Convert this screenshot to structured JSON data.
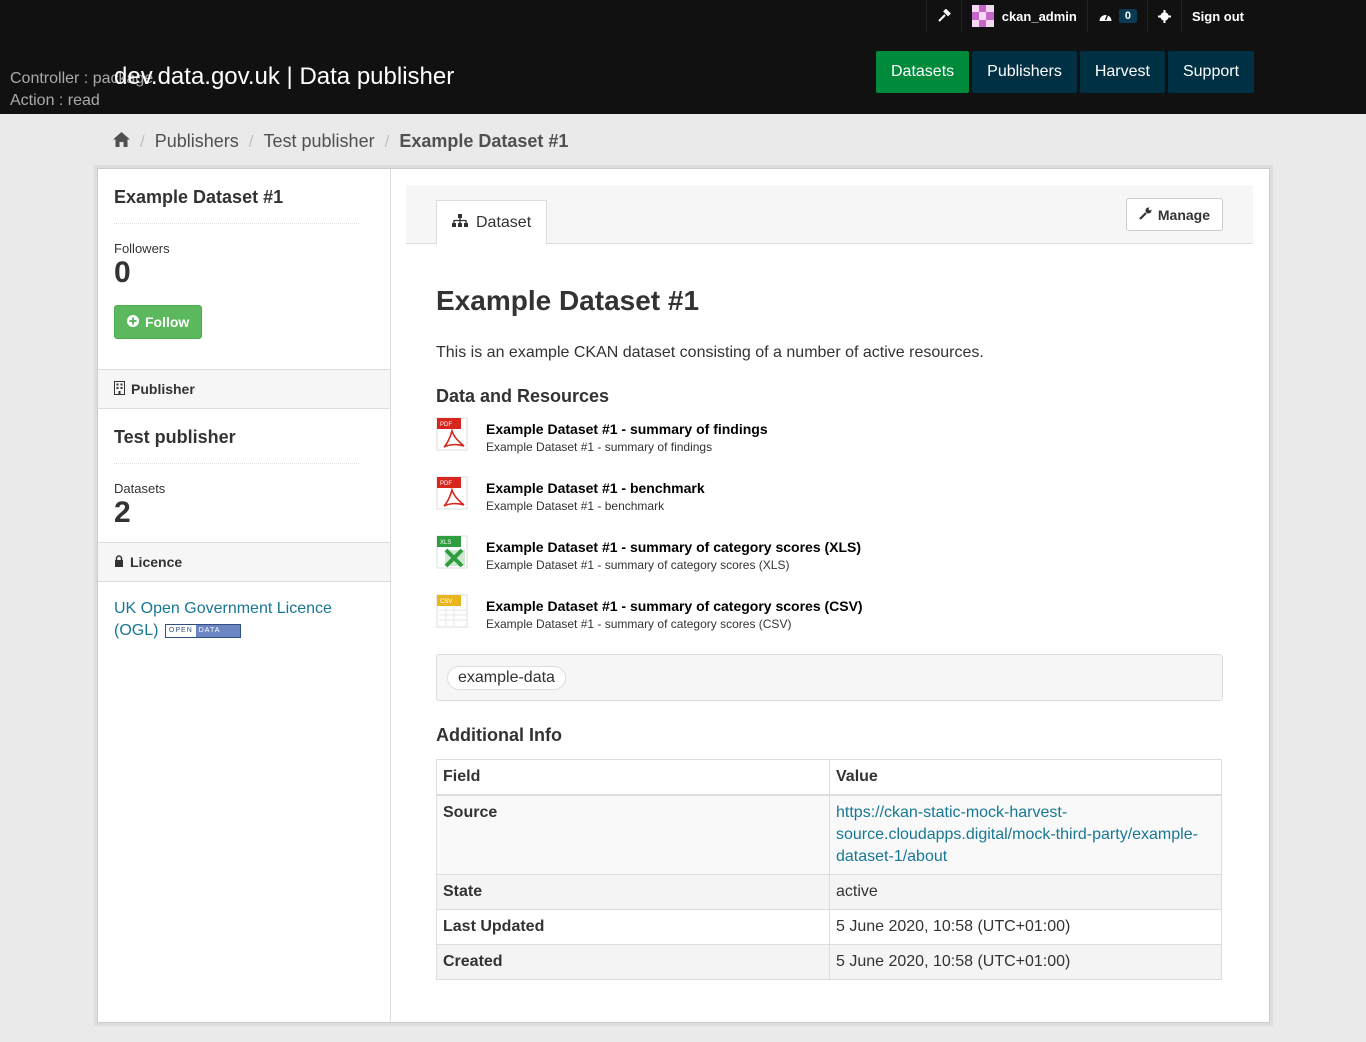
{
  "account": {
    "username": "ckan_admin",
    "dashboard_count": "0",
    "signout_label": "Sign out"
  },
  "debug": {
    "controller": "Controller : package",
    "action": "Action : read"
  },
  "site": {
    "title": "dev.data.gov.uk | Data publisher"
  },
  "nav": {
    "items": [
      {
        "label": "Datasets",
        "active": true
      },
      {
        "label": "Publishers",
        "active": false
      },
      {
        "label": "Harvest",
        "active": false
      },
      {
        "label": "Support",
        "active": false
      }
    ]
  },
  "breadcrumb": {
    "items": [
      "Publishers",
      "Test publisher"
    ],
    "current": "Example Dataset #1"
  },
  "sidebar": {
    "dataset_title": "Example Dataset #1",
    "followers_label": "Followers",
    "followers_count": "0",
    "follow_label": "Follow",
    "publisher_heading": "Publisher",
    "publisher_name": "Test publisher",
    "datasets_label": "Datasets",
    "datasets_count": "2",
    "licence_heading": "Licence",
    "licence_text": "UK Open Government Licence (OGL)",
    "ogl_badge_open": "OPEN",
    "ogl_badge_data": "DATA"
  },
  "tabs": {
    "dataset_label": "Dataset",
    "manage_label": "Manage"
  },
  "dataset": {
    "title": "Example Dataset #1",
    "notes": "This is an example CKAN dataset consisting of a number of active resources.",
    "resources_heading": "Data and Resources",
    "resources": [
      {
        "name": "Example Dataset #1 - summary of findings",
        "description": "Example Dataset #1 - summary of findings",
        "format": "PDF",
        "color": "#d8261f"
      },
      {
        "name": "Example Dataset #1 - benchmark",
        "description": "Example Dataset #1 - benchmark",
        "format": "PDF",
        "color": "#d8261f"
      },
      {
        "name": "Example Dataset #1 - summary of category scores (XLS)",
        "description": "Example Dataset #1 - summary of category scores (XLS)",
        "format": "XLS",
        "color": "#2e9e3f"
      },
      {
        "name": "Example Dataset #1 - summary of category scores (CSV)",
        "description": "Example Dataset #1 - summary of category scores (CSV)",
        "format": "CSV",
        "color": "#e8b51e"
      }
    ],
    "tags": [
      "example-data"
    ],
    "additional_info_heading": "Additional Info",
    "table": {
      "headers": [
        "Field",
        "Value"
      ],
      "rows": [
        {
          "field": "Source",
          "value": "https://ckan-static-mock-harvest-source.cloudapps.digital/mock-third-party/example-dataset-1/about"
        },
        {
          "field": "State",
          "value": "active"
        },
        {
          "field": "Last Updated",
          "value": "5 June 2020, 10:58 (UTC+01:00)"
        },
        {
          "field": "Created",
          "value": "5 June 2020, 10:58 (UTC+01:00)"
        }
      ]
    }
  }
}
